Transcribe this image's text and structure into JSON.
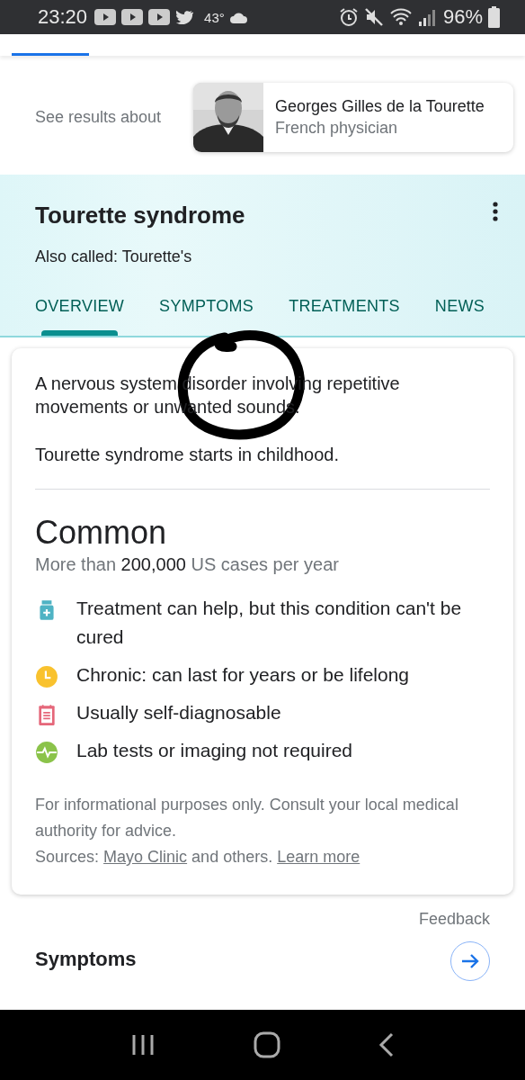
{
  "status_bar": {
    "time": "23:20",
    "temperature": "43°",
    "battery": "96%"
  },
  "see_results": {
    "label": "See results about",
    "entity": {
      "name": "Georges Gilles de la Tourette",
      "description": "French physician"
    }
  },
  "panel": {
    "title": "Tourette syndrome",
    "also_called": "Also called: Tourette's",
    "tabs": [
      {
        "label": "OVERVIEW",
        "selected": true
      },
      {
        "label": "SYMPTOMS",
        "selected": false
      },
      {
        "label": "TREATMENTS",
        "selected": false
      },
      {
        "label": "NEWS",
        "selected": false
      }
    ]
  },
  "overview": {
    "description": "A nervous system disorder involving repetitive movements or unwanted sounds.",
    "onset": "Tourette syndrome starts in childhood.",
    "prevalence": "Common",
    "cases": "More than **200,000** US cases per year",
    "facts": [
      {
        "kind": "treatment",
        "text": "Treatment can help, but this condition can't be cured"
      },
      {
        "kind": "duration",
        "text": "Chronic: can last for years or be lifelong"
      },
      {
        "kind": "diagnosis",
        "text": "Usually self-diagnosable"
      },
      {
        "kind": "tests",
        "text": "Lab tests or imaging not required"
      }
    ],
    "disclaimer": "For informational purposes only. Consult your local medical authority for advice.",
    "sources": {
      "prefix": "Sources:",
      "link": "Mayo Clinic",
      "middle": "and others.",
      "learn_more": "Learn more"
    }
  },
  "feedback": "Feedback",
  "next_section": {
    "title": "Symptoms"
  }
}
